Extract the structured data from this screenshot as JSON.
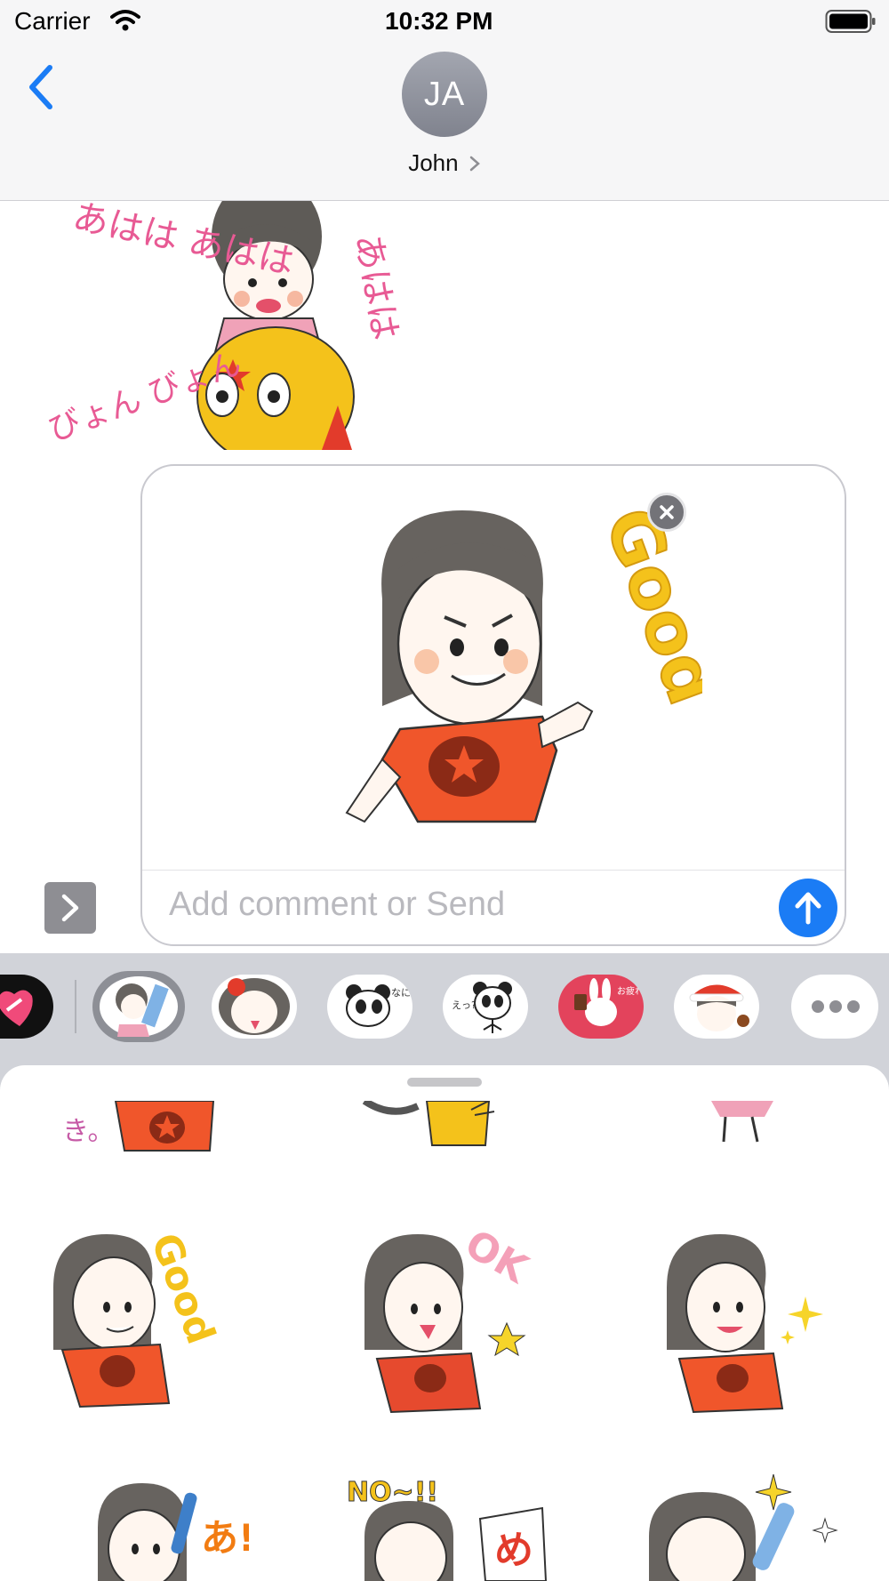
{
  "status_bar": {
    "carrier": "Carrier",
    "time": "10:32 PM"
  },
  "nav": {
    "avatar_initials": "JA",
    "contact_name": "John"
  },
  "thread": {
    "sticker_lettering_left": "あはは あはは",
    "sticker_lettering_right": "あはは",
    "sticker_lettering_bottom": "びょん びょん"
  },
  "compose": {
    "placeholder": "Add comment or Send",
    "sticker_lettering": "Good"
  },
  "app_drawer": {
    "apps": [
      {
        "name": "sticker-app-heart-icon"
      },
      {
        "name": "sticker-app-girl-selected-icon"
      },
      {
        "name": "sticker-app-girl-bow-icon"
      },
      {
        "name": "sticker-app-panda-icon",
        "caption": "なにか?"
      },
      {
        "name": "sticker-app-panda-2-icon",
        "caption": "えっ?"
      },
      {
        "name": "sticker-app-rabbit-icon",
        "caption": "お疲れ!"
      },
      {
        "name": "sticker-app-santa-girl-icon"
      },
      {
        "name": "more-apps-icon"
      }
    ]
  },
  "sticker_grid": {
    "row_partial": [
      {
        "lettering": "き。"
      },
      {
        "lettering": ""
      },
      {
        "lettering": ""
      }
    ],
    "row_main": [
      {
        "lettering": "Good"
      },
      {
        "lettering": "OK"
      },
      {
        "lettering": ""
      }
    ],
    "row_bottom": [
      {
        "lettering": "あ!"
      },
      {
        "lettering": "NO~!!"
      },
      {
        "lettering": "め"
      }
    ]
  },
  "colors": {
    "accent_blue": "#1b7cf5",
    "shirt_orange": "#f0562b",
    "sticker_yellow": "#f4c21b",
    "drawer_gray": "#d1d3d9",
    "nav_gray": "#f6f6f7"
  }
}
